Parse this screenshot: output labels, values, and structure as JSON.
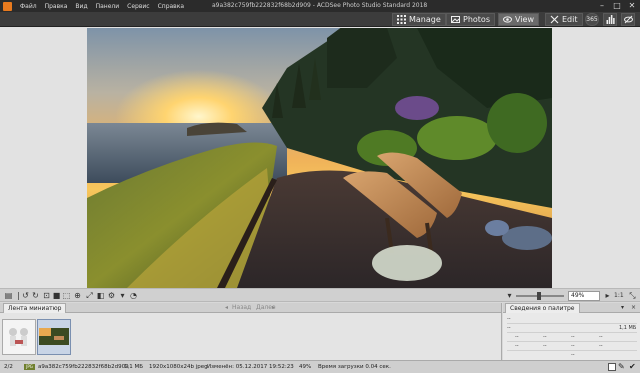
{
  "menu": {
    "items": [
      "Файл",
      "Правка",
      "Вид",
      "Панели",
      "Сервис",
      "Справка"
    ]
  },
  "window": {
    "title": "a9a382c759fb222832f68b2d909 - ACDSee Photo Studio Standard 2018",
    "minimize": "–",
    "maximize": "□",
    "close": "✕"
  },
  "modes": {
    "manage": "Manage",
    "photos": "Photos",
    "view": "View",
    "edit": "Edit",
    "badge": "365"
  },
  "filmstrip": {
    "tab_label": "Лента миниатюр",
    "prev_label": "Назад",
    "next_label": "Далее"
  },
  "zoom": {
    "value": "49%",
    "ratio_label": "1:1"
  },
  "palette": {
    "title": "Сведения о палитре",
    "top_left": "--",
    "top_right": "",
    "size": "1,1 МБ",
    "cells": "--"
  },
  "status": {
    "index": "2/2",
    "format": "JPG",
    "filename": "a9a382c759fb222832f68b2d909",
    "size": "1,1 МБ",
    "dimensions": "1920x1080x24b jpeg",
    "modified": "Изменён: 05.12.2017 19:52:23",
    "zoom": "49%",
    "load_time": "Время загрузки 0.04 сек."
  },
  "colors": {
    "titlebar": "#2b2b2b",
    "modebar": "#3c3c3c",
    "app_accent": "#e87a1e"
  }
}
